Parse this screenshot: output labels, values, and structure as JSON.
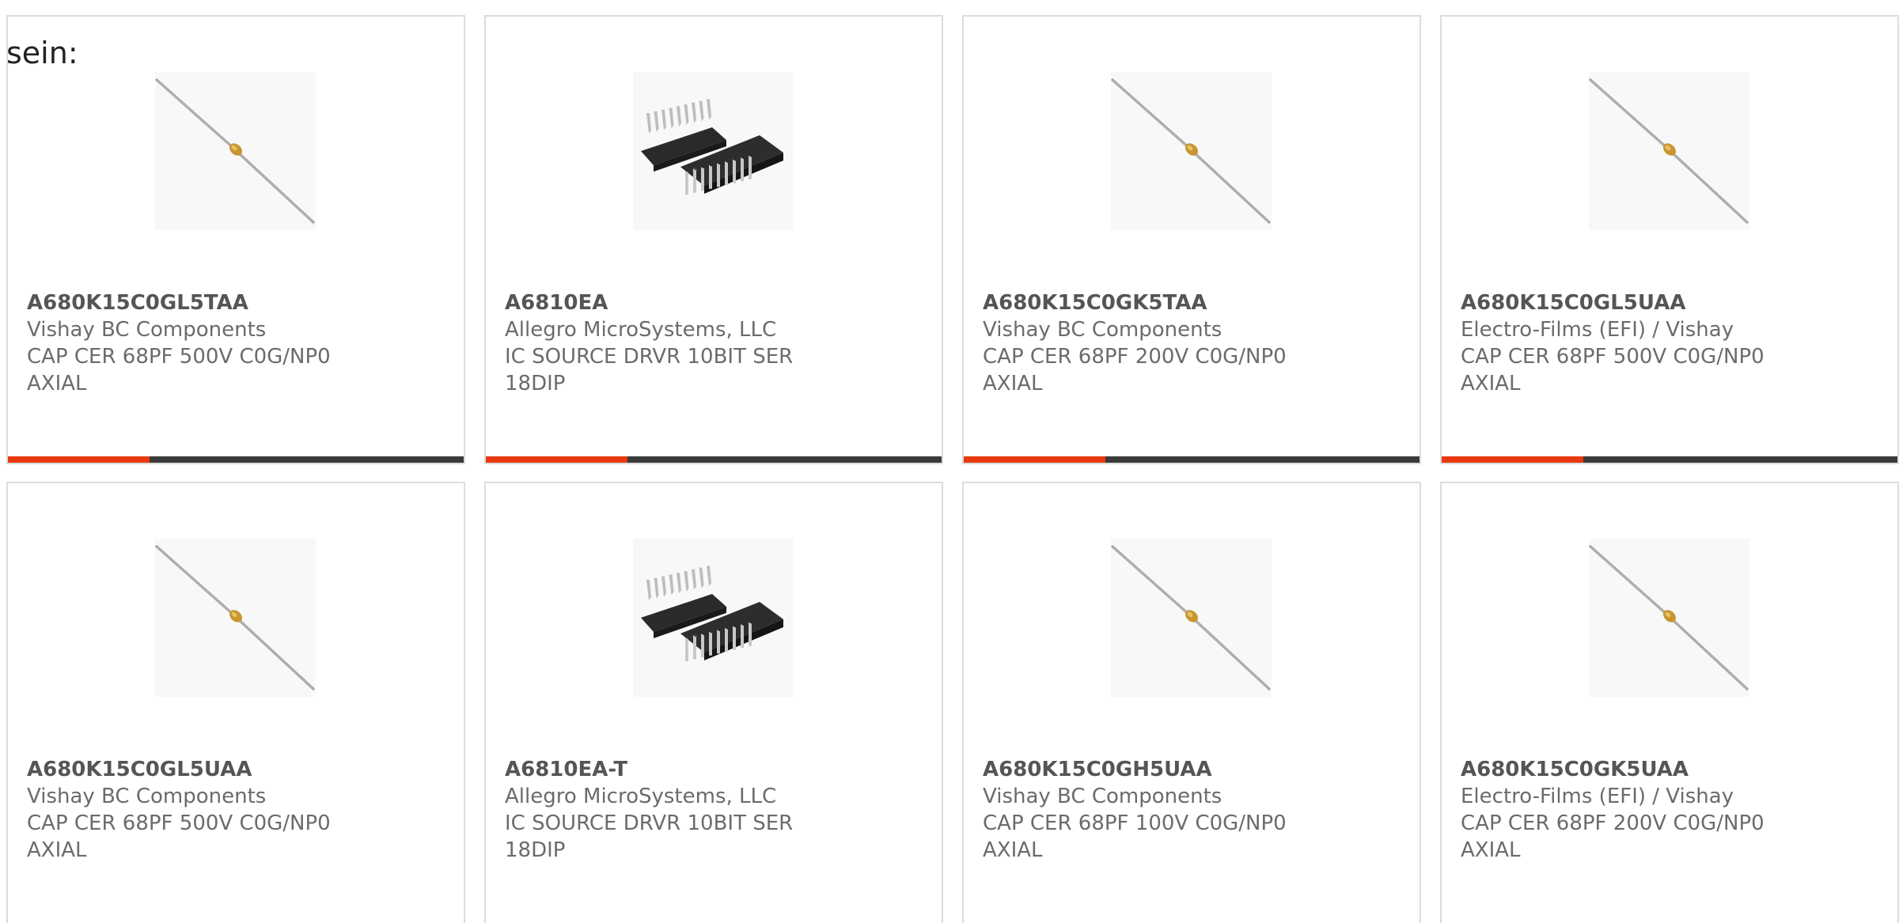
{
  "intro_text": "sein:",
  "colors": {
    "accent": "#e8380d",
    "bar_track": "#3a3a3a",
    "card_border": "#dcdcdc",
    "text": "#6b6b6b"
  },
  "products": [
    {
      "part_number": "A680K15C0GL5TAA",
      "manufacturer": "Vishay BC Components",
      "description_line1": "CAP CER 68PF 500V C0G/NP0",
      "description_line2": "AXIAL",
      "image_icon": "axial-capacitor-icon",
      "hover_progress": 0.31
    },
    {
      "part_number": "A6810EA",
      "manufacturer": "Allegro MicroSystems, LLC",
      "description_line1": "IC SOURCE DRVR 10BIT SER",
      "description_line2": "18DIP",
      "image_icon": "dip-ic-icon",
      "hover_progress": 0.31
    },
    {
      "part_number": "A680K15C0GK5TAA",
      "manufacturer": "Vishay BC Components",
      "description_line1": "CAP CER 68PF 200V C0G/NP0",
      "description_line2": "AXIAL",
      "image_icon": "axial-capacitor-icon",
      "hover_progress": 0.31
    },
    {
      "part_number": "A680K15C0GL5UAA",
      "manufacturer": "Electro-Films (EFI) / Vishay",
      "description_line1": "CAP CER 68PF 500V C0G/NP0",
      "description_line2": "AXIAL",
      "image_icon": "axial-capacitor-icon",
      "hover_progress": 0.31
    },
    {
      "part_number": "A680K15C0GL5UAA",
      "manufacturer": "Vishay BC Components",
      "description_line1": "CAP CER 68PF 500V C0G/NP0",
      "description_line2": "AXIAL",
      "image_icon": "axial-capacitor-icon",
      "hover_progress": null
    },
    {
      "part_number": "A6810EA-T",
      "manufacturer": "Allegro MicroSystems, LLC",
      "description_line1": "IC SOURCE DRVR 10BIT SER",
      "description_line2": "18DIP",
      "image_icon": "dip-ic-icon",
      "hover_progress": null
    },
    {
      "part_number": "A680K15C0GH5UAA",
      "manufacturer": "Vishay BC Components",
      "description_line1": "CAP CER 68PF 100V C0G/NP0",
      "description_line2": "AXIAL",
      "image_icon": "axial-capacitor-icon",
      "hover_progress": null
    },
    {
      "part_number": "A680K15C0GK5UAA",
      "manufacturer": "Electro-Films (EFI) / Vishay",
      "description_line1": "CAP CER 68PF 200V C0G/NP0",
      "description_line2": "AXIAL",
      "image_icon": "axial-capacitor-icon",
      "hover_progress": null
    }
  ]
}
